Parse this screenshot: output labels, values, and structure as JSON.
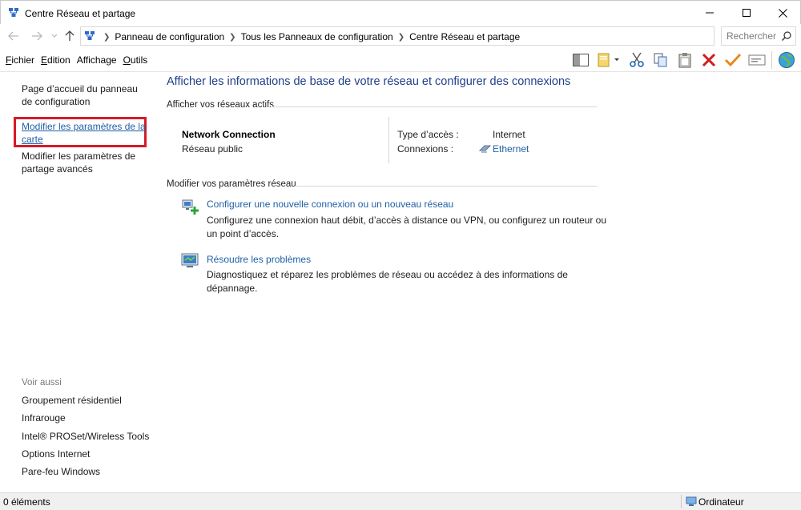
{
  "window": {
    "title": "Centre Réseau et partage"
  },
  "address": {
    "breadcrumbs": [
      "Panneau de configuration",
      "Tous les Panneaux de configuration",
      "Centre Réseau et partage"
    ],
    "search_placeholder": "Rechercher"
  },
  "menu": {
    "items": [
      {
        "label": "Fichier",
        "accel": "F",
        "rest": "ichier"
      },
      {
        "label": "Edition",
        "accel": "E",
        "rest": "dition"
      },
      {
        "label": "Affichage",
        "accel_html_before": "Afficha",
        "accel": "g",
        "rest": "e"
      },
      {
        "label": "Outils",
        "accel": "O",
        "rest": "utils"
      }
    ]
  },
  "sidebar": {
    "home": "Page d’accueil du panneau de configuration",
    "change_adapter": "Modifier les paramètres de la carte",
    "advanced_sharing": "Modifier les paramètres de partage avancés",
    "see_also_title": "Voir aussi",
    "see_also": [
      "Groupement résidentiel",
      "Infrarouge",
      "Intel® PROSet/Wireless Tools",
      "Options Internet",
      "Pare-feu Windows"
    ]
  },
  "main": {
    "title": "Afficher les informations de base de votre réseau et configurer des connexions",
    "active_networks_heading": "Afficher vos réseaux actifs",
    "network_name": "Network Connection",
    "network_type": "Réseau public",
    "access_type_label": "Type d’accès :",
    "access_type_value": "Internet",
    "connections_label": "Connexions :",
    "connections_value": "Ethernet",
    "change_settings_heading": "Modifier vos paramètres réseau",
    "task1_link": "Configurer une nouvelle connexion ou un nouveau réseau",
    "task1_desc": "Configurez une connexion haut débit, d’accès à distance ou VPN, ou configurez un routeur ou un point d’accès.",
    "task2_link": "Résoudre les problèmes",
    "task2_desc": "Diagnostiquez et réparez les problèmes de réseau ou accédez à des informations de dépannage."
  },
  "status": {
    "items_count": "0 éléments",
    "zone": "Ordinateur"
  }
}
